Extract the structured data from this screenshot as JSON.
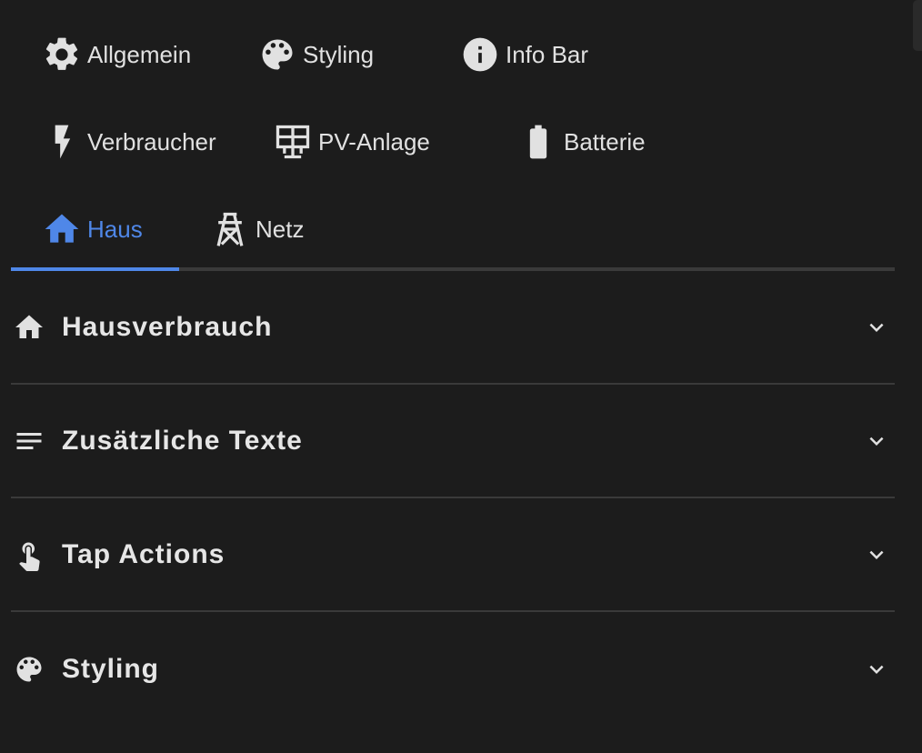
{
  "tabs": {
    "row1": [
      {
        "label": "Allgemein",
        "icon": "gear-icon"
      },
      {
        "label": "Styling",
        "icon": "palette-icon"
      },
      {
        "label": "Info Bar",
        "icon": "info-icon"
      }
    ],
    "row2": [
      {
        "label": "Verbraucher",
        "icon": "lightning-icon"
      },
      {
        "label": "PV-Anlage",
        "icon": "solar-panel-icon"
      },
      {
        "label": "Batterie",
        "icon": "battery-icon"
      }
    ],
    "row3": [
      {
        "label": "Haus",
        "icon": "home-icon",
        "active": true
      },
      {
        "label": "Netz",
        "icon": "transmission-tower-icon"
      }
    ]
  },
  "sections": [
    {
      "title": "Hausverbrauch",
      "icon": "home-icon"
    },
    {
      "title": "Zusätzliche Texte",
      "icon": "text-lines-icon"
    },
    {
      "title": "Tap Actions",
      "icon": "gesture-tap-icon"
    },
    {
      "title": "Styling",
      "icon": "palette-icon"
    }
  ],
  "colors": {
    "background": "#1c1c1c",
    "accent": "#4f87e8",
    "text": "#e1e1e1",
    "divider": "#3a3a3a"
  }
}
